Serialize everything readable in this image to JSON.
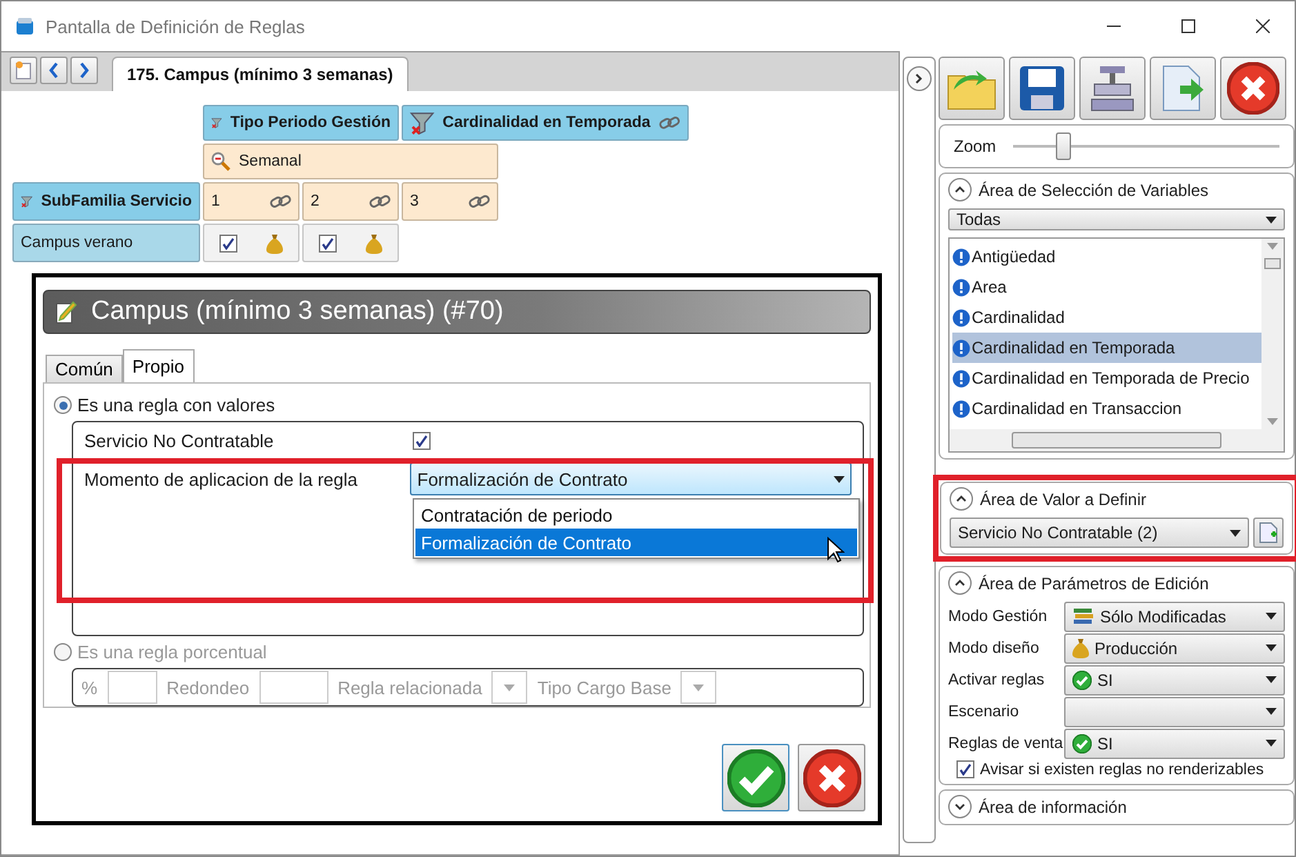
{
  "window": {
    "title": "Pantalla de Definición de Reglas"
  },
  "document_tab": {
    "label": "175. Campus (mínimo 3 semanas)",
    "selected": true
  },
  "grid": {
    "column_headers": [
      {
        "label": "Tipo Periodo Gestión",
        "linked": false
      },
      {
        "label": "Cardinalidad en Temporada",
        "linked": true
      }
    ],
    "period_value": "Semanal",
    "row_header": "SubFamilia Servicio",
    "cardinality_cells": [
      {
        "label": "1"
      },
      {
        "label": "2"
      },
      {
        "label": "3"
      }
    ],
    "row_label": "Campus verano",
    "value_cells": [
      {
        "checked": true
      },
      {
        "checked": true
      }
    ]
  },
  "rule_dialog": {
    "title": "Campus (mínimo 3 semanas) (#70)",
    "tabs": [
      {
        "label": "Común",
        "selected": false
      },
      {
        "label": "Propio",
        "selected": true
      }
    ],
    "value_rule": {
      "label": "Es una regla con valores",
      "selected": true,
      "fields": [
        {
          "kind": "checkbox",
          "label": "Servicio No Contratable",
          "checked": true
        },
        {
          "kind": "dropdown",
          "label": "Momento de aplicacion de la regla",
          "value": "Formalización de Contrato",
          "expanded": true,
          "options": [
            {
              "label": "Contratación de periodo",
              "selected": false
            },
            {
              "label": "Formalización de Contrato",
              "selected": true
            }
          ]
        }
      ]
    },
    "percent_rule": {
      "label": "Es una regla porcentual",
      "selected": false,
      "disabled": true,
      "fields": [
        {
          "kind": "input",
          "label": "%"
        },
        {
          "kind": "input",
          "label": "Redondeo"
        },
        {
          "kind": "select",
          "label": "Regla relacionada"
        },
        {
          "kind": "select",
          "label": "Tipo Cargo Base"
        }
      ]
    }
  },
  "side_panel": {
    "zoom": {
      "label": "Zoom",
      "level": 0.19
    },
    "variables": {
      "title": "Área de Selección de Variables",
      "expanded": true,
      "filter": "Todas",
      "items": [
        {
          "label": "Antigüedad",
          "selected": false
        },
        {
          "label": "Area",
          "selected": false
        },
        {
          "label": "Cardinalidad",
          "selected": false
        },
        {
          "label": "Cardinalidad en Temporada",
          "selected": true
        },
        {
          "label": "Cardinalidad en Temporada de Precio",
          "selected": false
        },
        {
          "label": "Cardinalidad en Transaccion",
          "selected": false
        }
      ]
    },
    "value_area": {
      "title": "Área de Valor a Definir",
      "expanded": true,
      "value": "Servicio No Contratable (2)"
    },
    "parameters": {
      "title": "Área de Parámetros de Edición",
      "expanded": true,
      "rows": [
        {
          "label": "Modo Gestión",
          "value": "Sólo Modificadas",
          "kind": "books"
        },
        {
          "label": "Modo diseño",
          "value": "Producción",
          "kind": "money"
        },
        {
          "label": "Activar reglas",
          "value": "SI",
          "kind": "check"
        },
        {
          "label": "Escenario",
          "kind": "none"
        },
        {
          "label": "Reglas de venta",
          "value": "SI",
          "kind": "check"
        }
      ],
      "warning": {
        "label": "Avisar si existen reglas no renderizables",
        "checked": true
      }
    },
    "info": {
      "title": "Área de información",
      "expanded": false
    }
  }
}
